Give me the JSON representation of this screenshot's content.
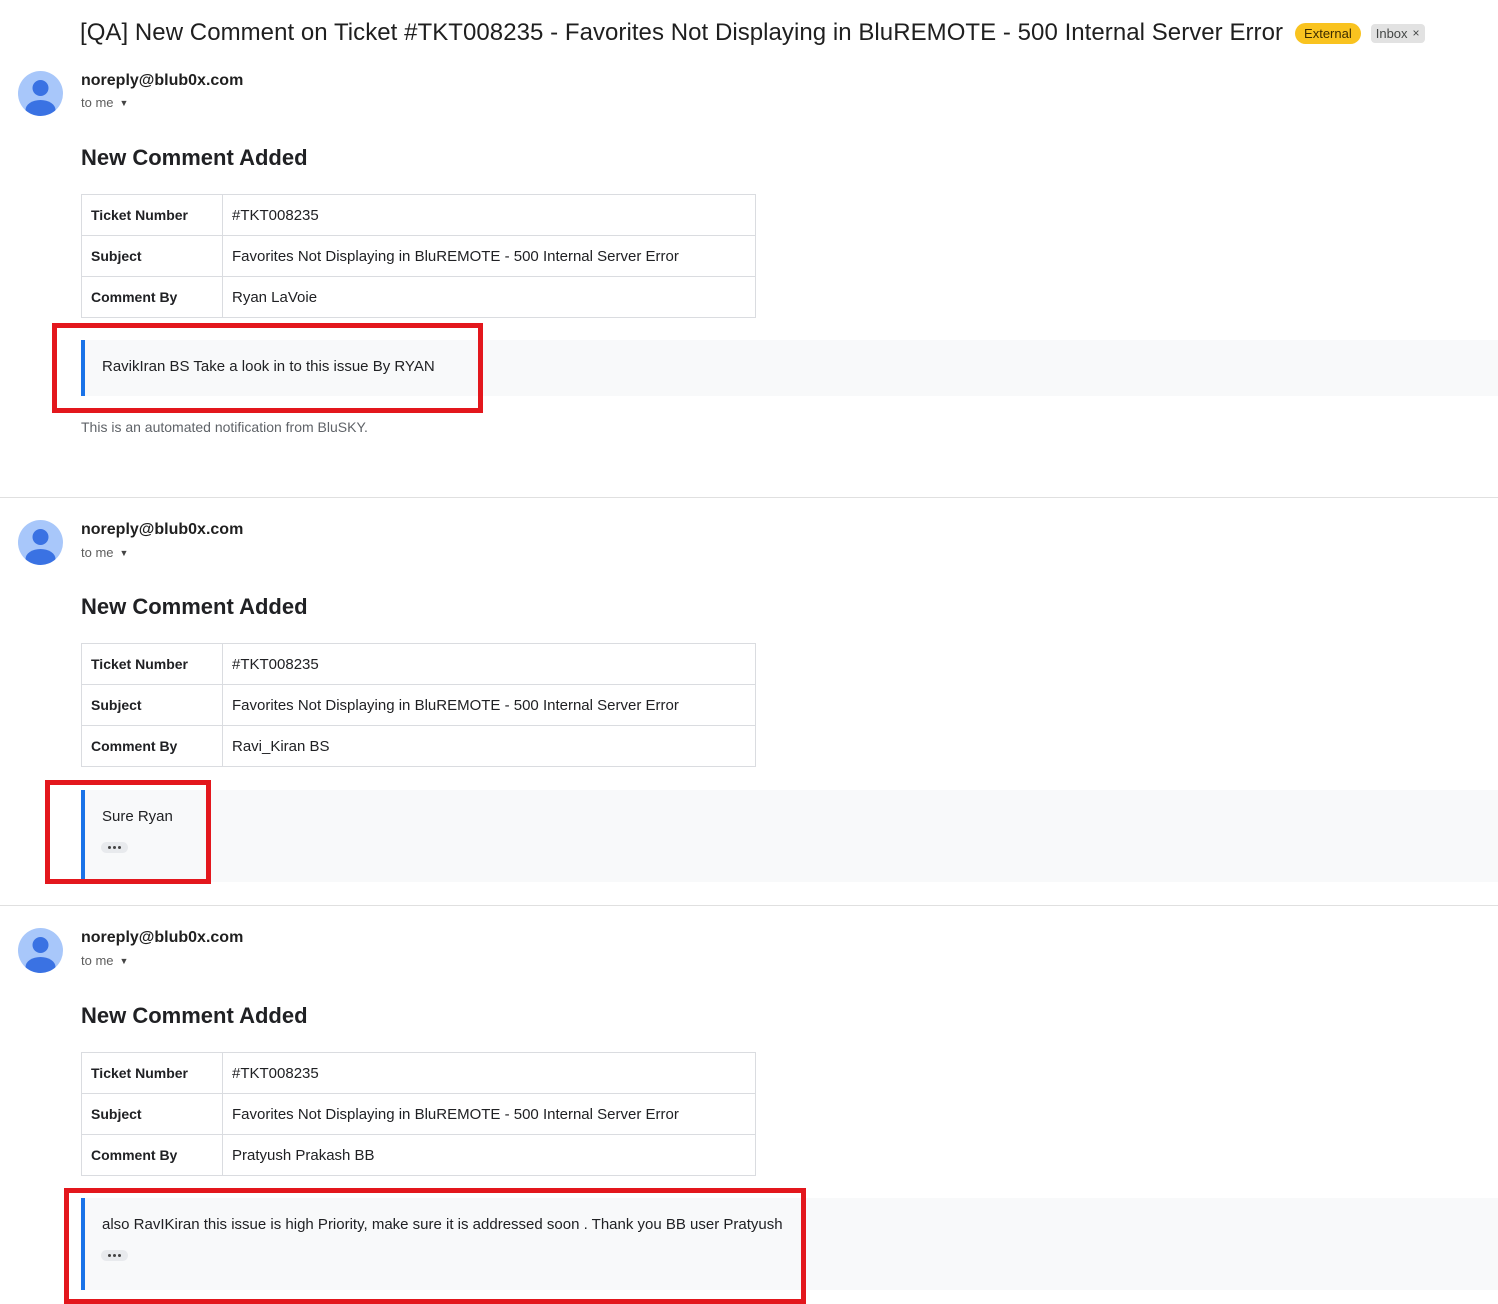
{
  "thread": {
    "subject": "[QA] New Comment on Ticket #TKT008235 - Favorites Not Displaying in BluREMOTE - 500 Internal Server Error",
    "labels": {
      "external": "External",
      "inbox": "Inbox",
      "inbox_remove": "×"
    }
  },
  "messages": [
    {
      "sender": "noreply@blub0x.com",
      "to": "to me",
      "heading": "New Comment Added",
      "rows": [
        {
          "key": "Ticket Number",
          "value": "#TKT008235"
        },
        {
          "key": "Subject",
          "value": "Favorites Not Displaying in BluREMOTE - 500 Internal Server Error"
        },
        {
          "key": "Comment By",
          "value": "Ryan LaVoie"
        }
      ],
      "comment": "RavikIran BS Take a look in to this issue By RYAN",
      "footer": "This is an automated notification from BluSKY."
    },
    {
      "sender": "noreply@blub0x.com",
      "to": "to me",
      "heading": "New Comment Added",
      "rows": [
        {
          "key": "Ticket Number",
          "value": "#TKT008235"
        },
        {
          "key": "Subject",
          "value": "Favorites Not Displaying in BluREMOTE - 500 Internal Server Error"
        },
        {
          "key": "Comment By",
          "value": "Ravi_Kiran BS"
        }
      ],
      "comment": "Sure Ryan"
    },
    {
      "sender": "noreply@blub0x.com",
      "to": "to me",
      "heading": "New Comment Added",
      "rows": [
        {
          "key": "Ticket Number",
          "value": "#TKT008235"
        },
        {
          "key": "Subject",
          "value": "Favorites Not Displaying in BluREMOTE - 500 Internal Server Error"
        },
        {
          "key": "Comment By",
          "value": "Pratyush Prakash BB"
        }
      ],
      "comment": "also RavIKiran this issue is high Priority, make sure it is addressed soon . Thank you BB user Pratyush"
    }
  ],
  "colors": {
    "highlight_box": "#e3171d",
    "comment_accent": "#1a73e8",
    "external_label": "#f9c31f",
    "avatar_bg": "#a8c7fa",
    "avatar_fg": "#3a72e3"
  },
  "icons": {
    "avatar": "person-avatar-icon",
    "to_me_caret": "caret-down-icon",
    "show_trimmed": "more-horiz-icon",
    "remove_label": "close-icon"
  }
}
